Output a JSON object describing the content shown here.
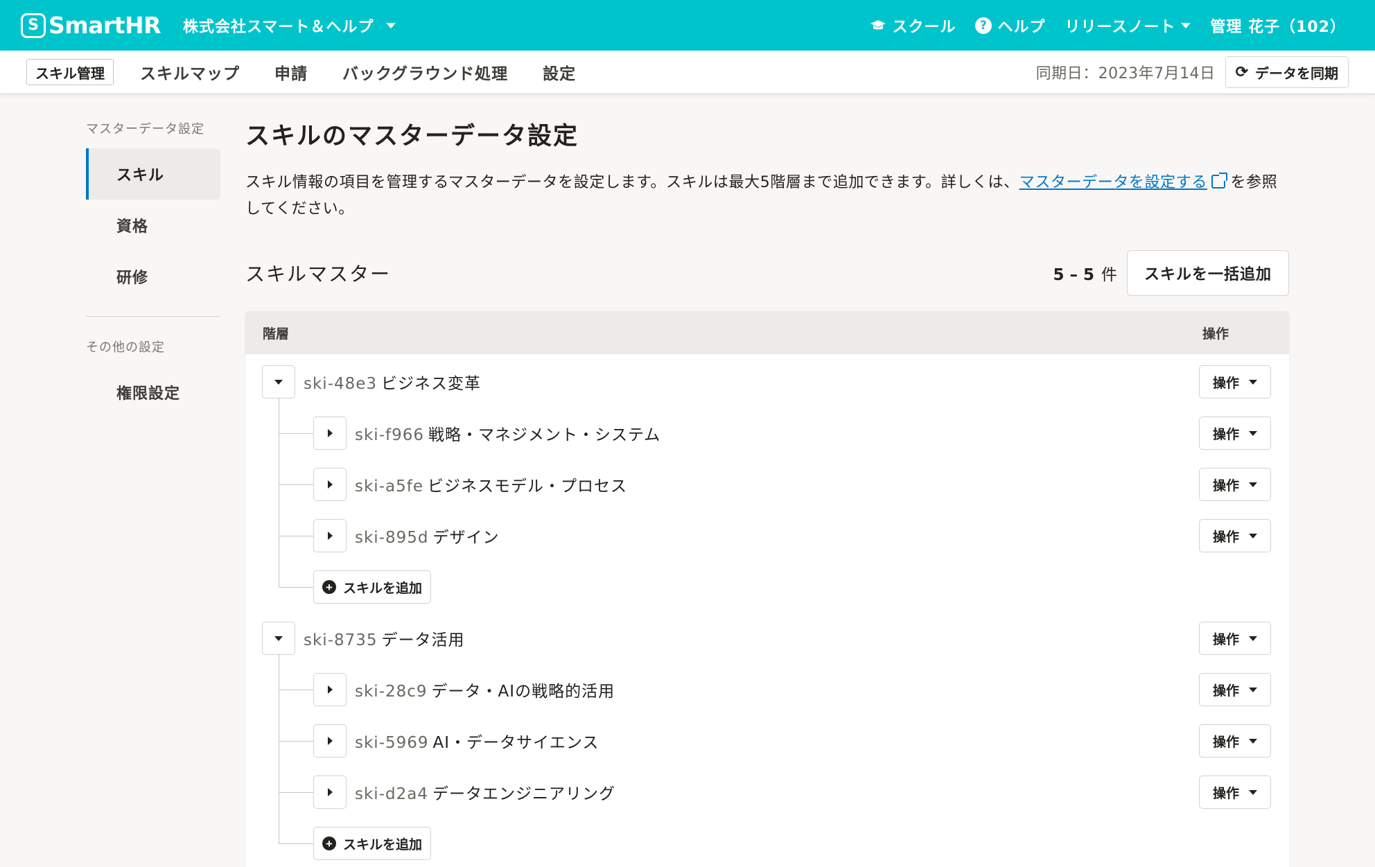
{
  "app": {
    "logo_mark": "S",
    "logo_text": "SmartHR",
    "company": "株式会社スマート＆ヘルプ"
  },
  "topnav": {
    "school": "スクール",
    "help": "ヘルプ",
    "release_notes": "リリースノート",
    "user": "管理 花子（102）"
  },
  "subnav": {
    "app_name": "スキル管理",
    "links": [
      "スキルマップ",
      "申請",
      "バックグラウンド処理",
      "設定"
    ],
    "sync_date": "同期日：2023年7月14日",
    "sync_button": "データを同期"
  },
  "sidemenu": {
    "master_heading": "マスターデータ設定",
    "master_items": [
      "スキル",
      "資格",
      "研修"
    ],
    "other_heading": "その他の設定",
    "other_items": [
      "権限設定"
    ]
  },
  "main": {
    "title": "スキルのマスターデータ設定",
    "desc_before": "スキル情報の項目を管理するマスターデータを設定します。スキルは最大5階層まで追加できます。詳しくは、",
    "desc_link": "マスターデータを設定する",
    "desc_after": "を参照してください。",
    "section_title": "スキルマスター",
    "count_range": "5 – 5",
    "count_unit": "件",
    "bulk_add": "スキルを一括追加"
  },
  "table": {
    "col_layer": "階層",
    "col_ops": "操作",
    "op_label": "操作",
    "add_label": "スキルを追加",
    "groups": [
      {
        "id": "ski-48e3",
        "name": "ビジネス変革",
        "children": [
          {
            "id": "ski-f966",
            "name": "戦略・マネジメント・システム"
          },
          {
            "id": "ski-a5fe",
            "name": "ビジネスモデル・プロセス"
          },
          {
            "id": "ski-895d",
            "name": "デザイン"
          }
        ]
      },
      {
        "id": "ski-8735",
        "name": "データ活用",
        "children": [
          {
            "id": "ski-28c9",
            "name": "データ・AIの戦略的活用"
          },
          {
            "id": "ski-5969",
            "name": "AI・データサイエンス"
          },
          {
            "id": "ski-d2a4",
            "name": "データエンジニアリング"
          }
        ]
      }
    ]
  },
  "colors": {
    "brand": "#00c4cc",
    "link": "#0077c7",
    "text": "#23221f"
  }
}
